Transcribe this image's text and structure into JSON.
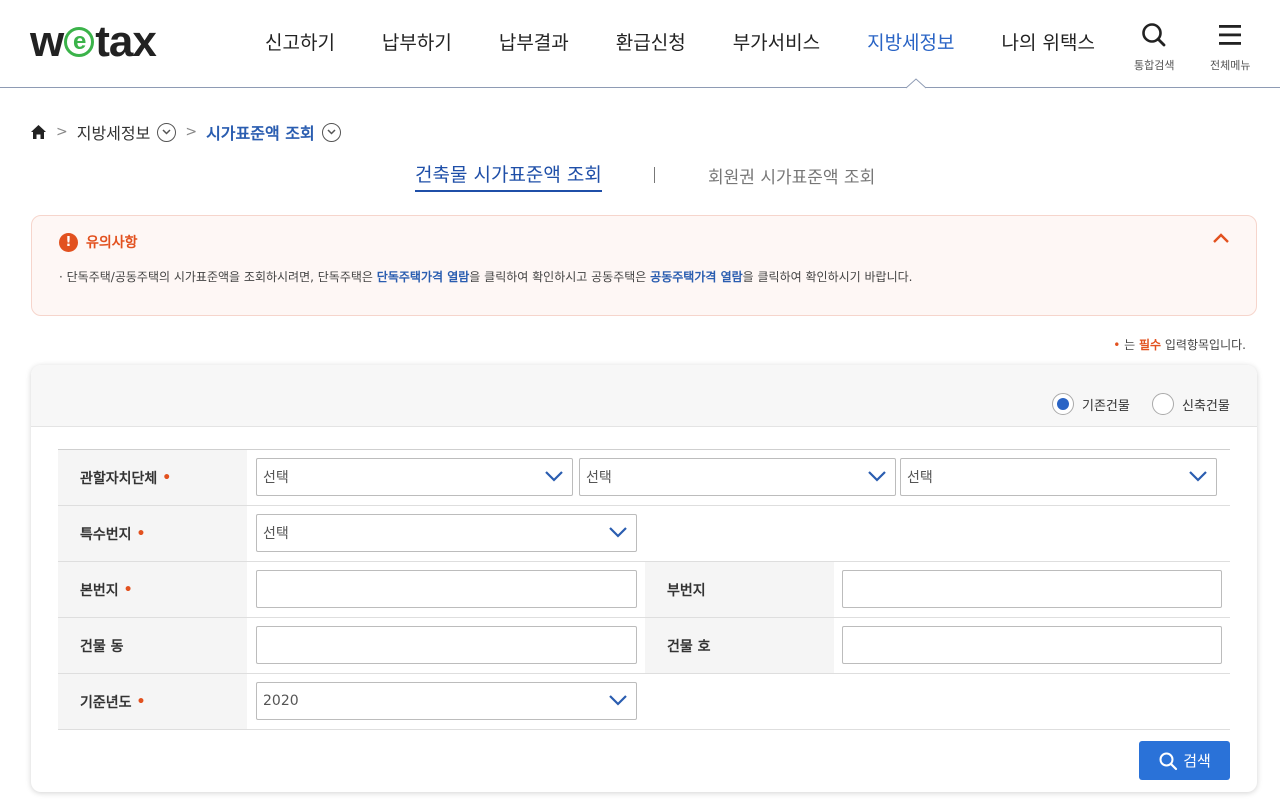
{
  "header": {
    "logo_w": "w",
    "logo_e": "e",
    "logo_rest": "tax",
    "nav": [
      {
        "label": "신고하기",
        "active": false
      },
      {
        "label": "납부하기",
        "active": false
      },
      {
        "label": "납부결과",
        "active": false
      },
      {
        "label": "환급신청",
        "active": false
      },
      {
        "label": "부가서비스",
        "active": false
      },
      {
        "label": "지방세정보",
        "active": true
      },
      {
        "label": "나의 위택스",
        "active": false
      }
    ],
    "search_label": "통합검색",
    "menu_label": "전체메뉴"
  },
  "breadcrumb": {
    "level1": "지방세정보",
    "level2": "시가표준액 조회"
  },
  "tabs": {
    "active": "건축물 시가표준액 조회",
    "inactive": "회원권 시가표준액 조회"
  },
  "notice": {
    "title": "유의사항",
    "text_1": "· 단독주택/공동주택의 시가표준액을 조회하시려면, 단독주택은 ",
    "link_1": "단독주택가격 열람",
    "text_2": "을 클릭하여 확인하시고 공동주택은 ",
    "link_2": "공동주택가격 열람",
    "text_3": "을 클릭하여 확인하시기 바랍니다."
  },
  "required_note": {
    "star": "•",
    "pre": " 는 ",
    "strong": "필수",
    "post": " 입력항목입니다."
  },
  "form": {
    "radio_existing": "기존건물",
    "radio_new": "신축건물",
    "selected_radio": "기존건물",
    "label_jurisdiction": "관할자치단체",
    "select_placeholder": "선택",
    "label_special": "특수번지",
    "label_main_no": "본번지",
    "label_sub_no": "부번지",
    "label_building_dong": "건물 동",
    "label_building_ho": "건물 호",
    "label_year": "기준년도",
    "year_value": "2020",
    "required_mark": "•",
    "search_button": "검색"
  },
  "colors": {
    "accent": "#2a64c5",
    "warning": "#e2511f",
    "button": "#2a72d8"
  }
}
